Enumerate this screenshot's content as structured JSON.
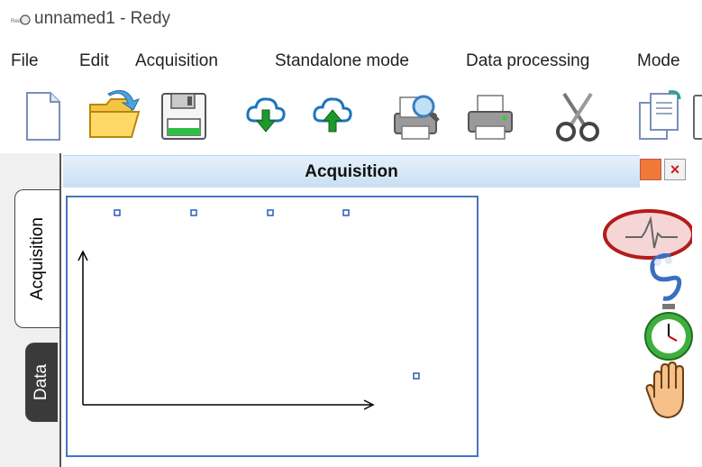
{
  "window": {
    "title": "unnamed1 - Redy",
    "app_icon_text": "Redy"
  },
  "menu": {
    "items": [
      "File",
      "Edit",
      "Acquisition",
      "Standalone mode",
      "Data processing",
      "Mode"
    ]
  },
  "toolbar": {
    "buttons": [
      "new-file",
      "open-folder",
      "save",
      "download-cloud",
      "upload-cloud",
      "print-preview",
      "print",
      "cut",
      "copy",
      "paste"
    ]
  },
  "tabs": {
    "acquisition": "Acquisition",
    "data": "Data"
  },
  "panel": {
    "title": "Acquisition"
  },
  "colors": {
    "accent_blue": "#4a72c4",
    "header_gradient_top": "#e6f1fb",
    "header_gradient_bottom": "#c9dff3",
    "highlight_red": "#b31b1b"
  }
}
